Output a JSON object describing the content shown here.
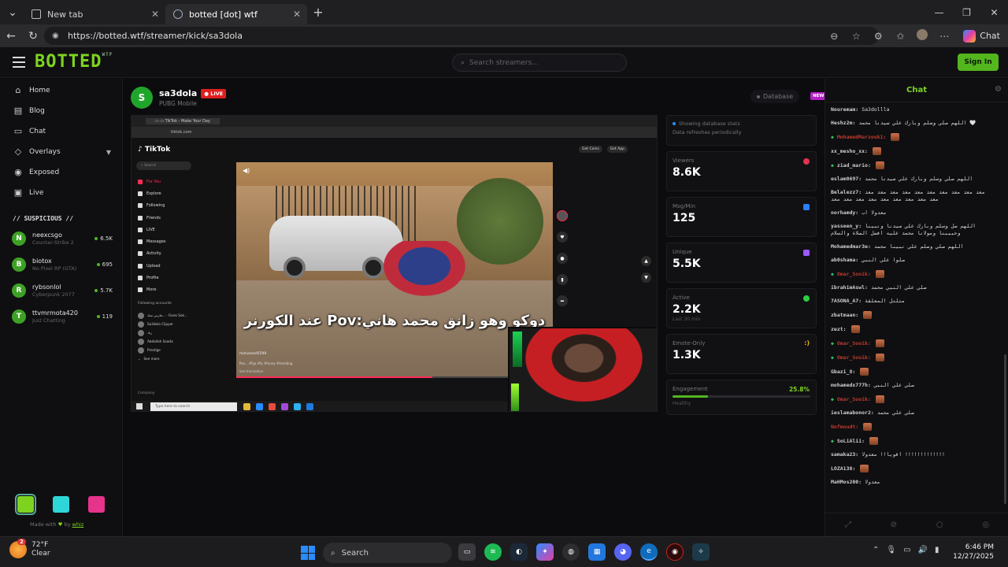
{
  "browser": {
    "tabs": [
      {
        "label": "New tab"
      },
      {
        "label": "botted [dot] wtf"
      }
    ],
    "url": "https://botted.wtf/streamer/kick/sa3dola",
    "copilot_label": "Chat"
  },
  "site": {
    "logo": "BOTTED",
    "logo_sup": "WTF",
    "search_placeholder": "Search streamers...",
    "signin": "Sign In"
  },
  "sidebar": {
    "nav": [
      {
        "label": "Home",
        "icon": "home-icon"
      },
      {
        "label": "Blog",
        "icon": "document-icon"
      },
      {
        "label": "Chat",
        "icon": "chat-icon"
      },
      {
        "label": "Overlays",
        "icon": "layers-icon"
      },
      {
        "label": "Exposed",
        "icon": "eye-icon"
      },
      {
        "label": "Live",
        "icon": "tv-icon"
      }
    ],
    "suspicious_title": "// SUSPICIOUS //",
    "suspicious": [
      {
        "initial": "N",
        "name": "neexcsgo",
        "game": "Counter-Strike 2",
        "count": "6.5K"
      },
      {
        "initial": "B",
        "name": "biotox",
        "game": "No Pixel RP (GTA)",
        "count": "695"
      },
      {
        "initial": "R",
        "name": "rybsonlol",
        "game": "Cyberpunk 2077",
        "count": "5.7K"
      },
      {
        "initial": "T",
        "name": "ttvmrmota420",
        "game": "Just Chatting",
        "count": "119"
      }
    ],
    "theme_colors": [
      "#7ed321",
      "#2fd6d9",
      "#e6338b"
    ],
    "made_with": "Made with",
    "made_by": "by",
    "made_author": "whiz"
  },
  "streamer": {
    "initial": "S",
    "name": "sa3dola",
    "live": "LIVE",
    "game": "PUBG Mobile",
    "database_label": "Database",
    "new_badge": "NEW"
  },
  "stream": {
    "tiktok_logo": "TikTok",
    "tiktok_search": "Search",
    "tiktok_menu": [
      "For You",
      "Explore",
      "Following",
      "Friends",
      "LIVE",
      "Messages",
      "Activity",
      "Upload",
      "Profile",
      "More"
    ],
    "following_title": "Following accounts",
    "following": [
      "فارس صك... - Fares Sok...",
      "fares_sokar_official",
      "Sa3dola Clipper",
      "ziad.mageb57",
      "زياد",
      "i3o0ff",
      "Abdallah Saada",
      "aasaada",
      "Prestige",
      "rut70"
    ],
    "see_more": "See more",
    "company": "Company",
    "top_buttons": [
      "Get Coins",
      "Get App"
    ],
    "caption": "دوكو وهو زانق محمد هاني:Pov عند الكورنر",
    "video_user": "mohamed5599",
    "video_desc": "Pov... #fyp #fy #funny #trending",
    "see_translation": "See translation",
    "taskbar_search": "Type here to search",
    "action_counts": [
      "5000",
      "376",
      "477"
    ]
  },
  "stats": {
    "info_line1": "Showing database stats",
    "info_line2": "Data refreshes periodically",
    "cards": [
      {
        "label": "Viewers",
        "value": "8.6K",
        "color": "#e0334f"
      },
      {
        "label": "Msg/Min",
        "value": "125",
        "color": "#2b7fff"
      },
      {
        "label": "Unique",
        "value": "5.5K",
        "color": "#9b59ff"
      },
      {
        "label": "Active",
        "value": "2.2K",
        "sub": "Last 30 min",
        "color": "#2ecc40"
      },
      {
        "label": "Emote-Only",
        "value": "1.3K",
        "badge": ":)",
        "color": "#e0b400"
      }
    ],
    "engagement": {
      "label": "Engagement",
      "value": "25.8%",
      "status": "Healthy",
      "fill": 25.8
    }
  },
  "chat": {
    "title": "Chat",
    "messages": [
      {
        "user": "Nouremam:",
        "text": "Sa3dollla",
        "color": "#cfcfcf"
      },
      {
        "user": "Heshz2m:",
        "text": "اللهم صلي وسلم وبارك علي سيدنا محمد 🤍",
        "color": "#cfcfcf"
      },
      {
        "user": "MohamedMarzouk1:",
        "text": "",
        "color": "#c0392b",
        "badge": true,
        "emote": true
      },
      {
        "user": "xx_mesho_xx:",
        "text": "",
        "color": "#cfcfcf",
        "emote": true
      },
      {
        "user": "ziad_mario:",
        "text": "",
        "color": "#cfcfcf",
        "badge": true,
        "emote": true
      },
      {
        "user": "eslam0697:",
        "text": "اللهم صلي وسلم وبارك علي سيدنا محمد",
        "color": "#cfcfcf"
      },
      {
        "user": "Belalezz7:",
        "text": "معد معد معد معد معد معد معد معد معد معد معد معد معد معد معد معد معد معد معد",
        "color": "#cfcfcf"
      },
      {
        "user": "norhamdy:",
        "text": "معدولا اب",
        "color": "#cfcfcf"
      },
      {
        "user": "yasseen_y:",
        "text": "اللهم صل وسلم وبارك علي سيدنا ونبينا وحبيبنا ومولانا محمد عليه افضل الصلاة والسلام",
        "color": "#cfcfcf"
      },
      {
        "user": "Mohamedmar3e:",
        "text": "اللهم صلي وسلم علي نبينا محمد",
        "color": "#cfcfcf"
      },
      {
        "user": "ab0shama:",
        "text": "صلوا علي النبي",
        "color": "#cfcfcf"
      },
      {
        "user": "Omar_Sooik:",
        "text": "",
        "color": "#c0392b",
        "badge": true,
        "emote": true
      },
      {
        "user": "ibrahimAswl:",
        "text": "صلي علي النبي محمد",
        "color": "#cfcfcf"
      },
      {
        "user": "7ASONA_A7:",
        "text": "متلتل المعلقة",
        "color": "#cfcfcf"
      },
      {
        "user": "zbatmaan:",
        "text": "",
        "color": "#cfcfcf",
        "emote": true
      },
      {
        "user": "zezt:",
        "text": "",
        "color": "#cfcfcf",
        "emote": true
      },
      {
        "user": "Omar_Sooik:",
        "text": "",
        "color": "#c0392b",
        "badge": true,
        "emote": true
      },
      {
        "user": "Omar_Sooik:",
        "text": "",
        "color": "#c0392b",
        "badge": true,
        "emote": true
      },
      {
        "user": "Gbazi_8:",
        "text": "",
        "color": "#cfcfcf",
        "emote": true
      },
      {
        "user": "mohamedx777h:",
        "text": "صلي علي النبي",
        "color": "#cfcfcf"
      },
      {
        "user": "Omar_Sooik:",
        "text": "",
        "color": "#c0392b",
        "badge": true,
        "emote": true
      },
      {
        "user": "ieslamabonor2:",
        "text": "صلي علي محمد",
        "color": "#cfcfcf"
      },
      {
        "user": "Nofmoudt:",
        "text": "",
        "color": "#c0392b",
        "emote": true
      },
      {
        "user": "SoLiAlii:",
        "text": "",
        "color": "#cfcfcf",
        "badge": true,
        "emote": true
      },
      {
        "user": "samaka23:",
        "text": "اقويا!! معدولا !!!!!!!!!!!!!",
        "color": "#cfcfcf"
      },
      {
        "user": "LOZA138:",
        "text": "",
        "color": "#cfcfcf",
        "emote": true
      },
      {
        "user": "MaHMos200:",
        "text": "معدولا",
        "color": "#cfcfcf"
      }
    ]
  },
  "taskbar": {
    "temp": "72°F",
    "weather": "Clear",
    "weather_badge": "2",
    "search": "Search",
    "time": "6:46 PM",
    "date": "12/27/2025"
  }
}
